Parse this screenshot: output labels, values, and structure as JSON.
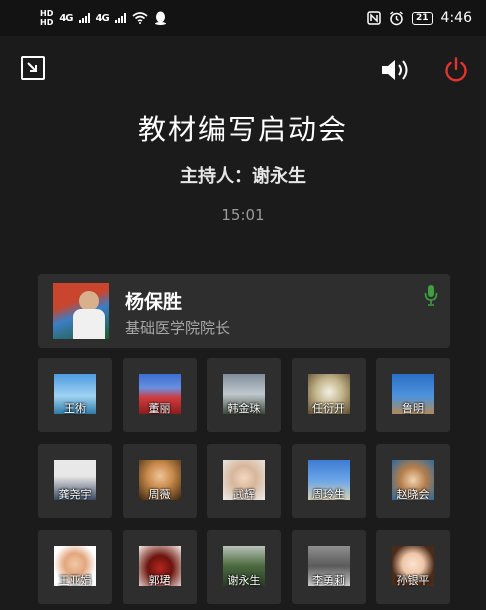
{
  "status_bar": {
    "hd1": "HD",
    "hd2": "HD",
    "sim1_type": "4G",
    "sim2_type": "4G",
    "battery": "21",
    "time": "4:46",
    "icons": [
      "nfc-icon",
      "alarm-icon",
      "wifi-icon",
      "qq-icon",
      "signal-icon"
    ]
  },
  "toolbar": {
    "icons": [
      "exit-fullscreen-icon",
      "speaker-icon",
      "power-icon"
    ],
    "power_color": "#e0342e"
  },
  "meeting": {
    "title": "教材编写启动会",
    "host_line": "主持人：谢永生",
    "elapsed": "15:01"
  },
  "active_speaker": {
    "name": "杨保胜",
    "role": "基础医学院院长",
    "mic_color": "#3fa03f"
  },
  "participants": [
    {
      "name": "王術"
    },
    {
      "name": "董丽"
    },
    {
      "name": "韩金珠"
    },
    {
      "name": "任衍开"
    },
    {
      "name": "鲁明"
    },
    {
      "name": "龚尧宇"
    },
    {
      "name": "周薇"
    },
    {
      "name": "武辉"
    },
    {
      "name": "周玲生"
    },
    {
      "name": "赵晓会"
    },
    {
      "name": "王亚娟"
    },
    {
      "name": "郭珺"
    },
    {
      "name": "谢永生"
    },
    {
      "name": "李勇莉"
    },
    {
      "name": "孙银平"
    }
  ]
}
